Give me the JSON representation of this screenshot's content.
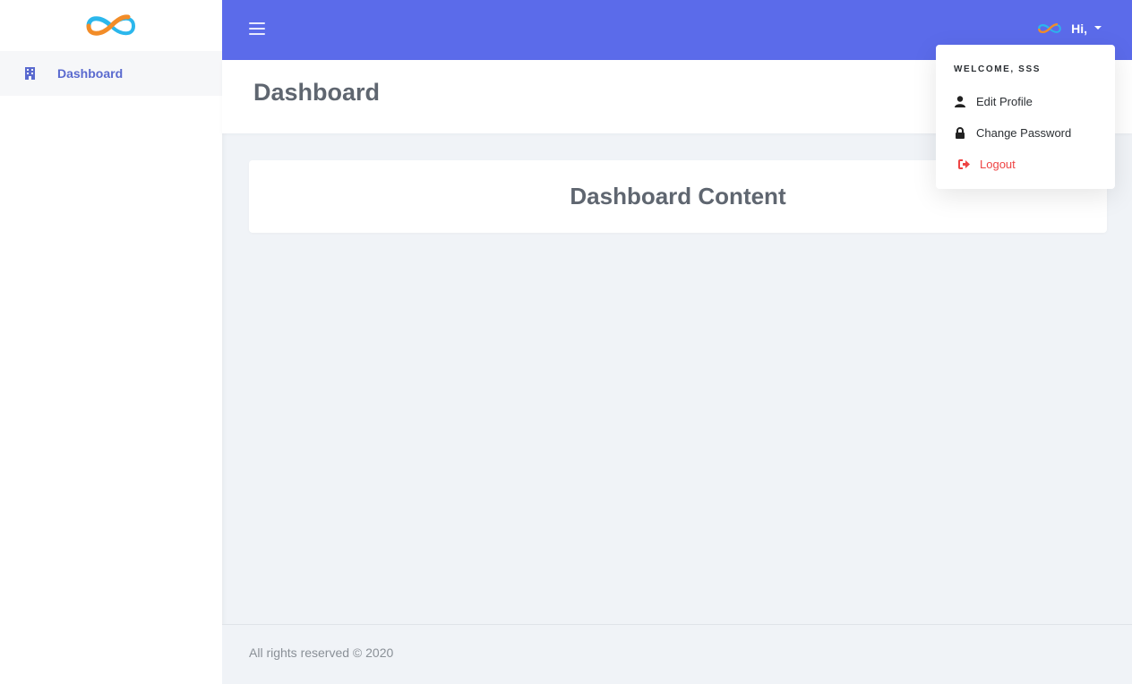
{
  "sidebar": {
    "brand": "infinity-logo",
    "items": [
      {
        "label": "Dashboard",
        "icon": "building-icon",
        "active": true
      }
    ]
  },
  "topbar": {
    "menu_icon": "hamburger-icon",
    "user_greeting": "Hi,",
    "avatar_icon": "infinity-logo"
  },
  "page": {
    "title": "Dashboard",
    "content_title": "Dashboard Content"
  },
  "user_menu": {
    "header": "WELCOME, SSS",
    "items": [
      {
        "label": "Edit Profile",
        "icon": "user-icon"
      },
      {
        "label": "Change Password",
        "icon": "lock-icon"
      },
      {
        "label": "Logout",
        "icon": "sign-out-icon"
      }
    ]
  },
  "footer": {
    "text": "All rights reserved © 2020"
  },
  "colors": {
    "accent": "#5b6bea",
    "sidebar_active_text": "#5a6acf",
    "logout": "#ee4444",
    "background": "#f0f3f7"
  }
}
